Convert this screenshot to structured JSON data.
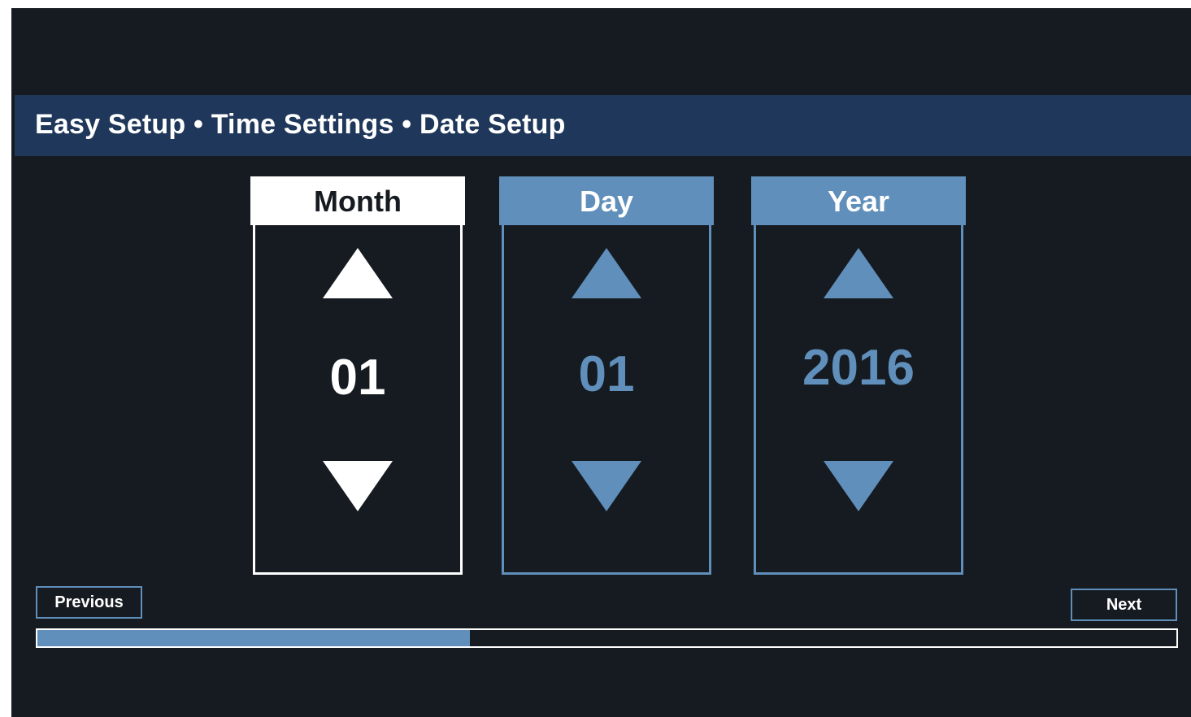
{
  "header": {
    "title": "Easy Setup • Time Settings • Date Setup"
  },
  "date_picker": {
    "month": {
      "label": "Month",
      "value": "01",
      "selected": true
    },
    "day": {
      "label": "Day",
      "value": "01",
      "selected": false
    },
    "year": {
      "label": "Year",
      "value": "2016",
      "selected": false
    }
  },
  "navigation": {
    "previous_label": "Previous",
    "next_label": "Next"
  },
  "progress": {
    "fraction": 0.38
  },
  "colors": {
    "background": "#161b21",
    "title_bar": "#1f375a",
    "accent": "#5f8fba",
    "selected": "#ffffff"
  },
  "icons": {
    "increment": "triangle-up-icon",
    "decrement": "triangle-down-icon"
  }
}
